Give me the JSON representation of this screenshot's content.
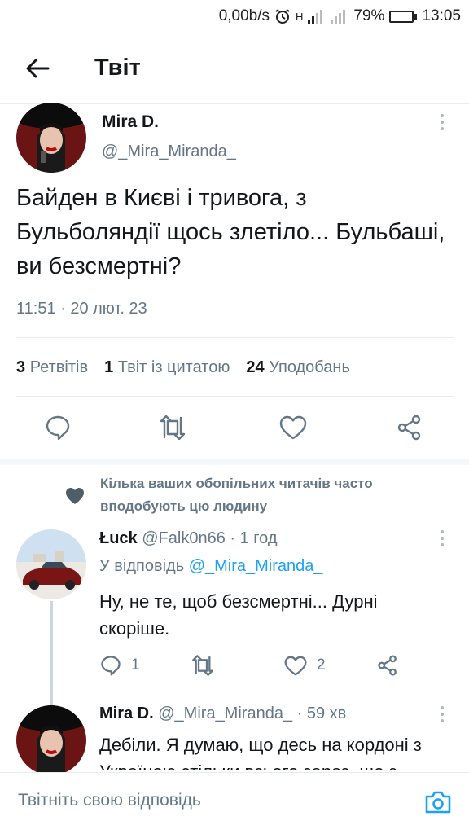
{
  "status_bar": {
    "network_speed": "0,00b/s",
    "signal_label": "H",
    "battery_percent": "79%",
    "battery_level": 0.79,
    "time": "13:05"
  },
  "header": {
    "title": "Твіт",
    "back_icon": "arrow-left-icon"
  },
  "main_tweet": {
    "author_name": "Mira D.",
    "author_handle": "@_Mira_Miranda_",
    "text": "Байден в Києві і тривога, з Бульболяндії щось злетіло... Бульбаші, ви безсмертні?",
    "timestamp": "11:51 · 20 лют. 23",
    "stats": {
      "retweets_count": "3",
      "retweets_label": "Ретвітів",
      "quotes_count": "1",
      "quotes_label": "Твіт із цитатою",
      "likes_count": "24",
      "likes_label": "Уподобань"
    }
  },
  "social_context": {
    "text": "Кілька ваших обопільних читачів часто вподобують цю людину"
  },
  "replies": [
    {
      "author_name": "Łuck",
      "author_handle": "@Falk0n66",
      "time": "· 1 год",
      "reply_to_prefix": "У відповідь",
      "reply_to_handle": "@_Mira_Miranda_",
      "text": "Ну, не те, щоб безсмертні... Дурні скоріше.",
      "reply_count": "1",
      "like_count": "2"
    },
    {
      "author_name": "Mira D.",
      "author_handle": "@_Mira_Miranda_",
      "time": "· 59 хв",
      "text": "Дебіли. Я думаю, що десь на кордоні з Україною стільки всього зараз, що з"
    }
  ],
  "compose": {
    "placeholder": "Твітніть свою відповідь"
  },
  "colors": {
    "accent": "#1da1f2",
    "muted": "#657786",
    "text": "#14171a",
    "divider": "#e6ecf0",
    "battery": "#27c13b"
  }
}
